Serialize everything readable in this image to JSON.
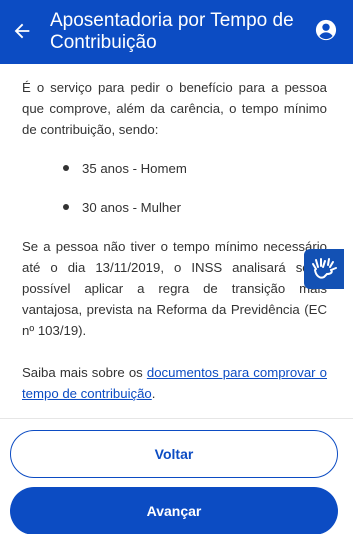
{
  "header": {
    "title": "Aposentadoria por Tempo de Contribuição",
    "back_icon": "arrow-left-icon",
    "account_icon": "user-circle-icon",
    "background": "#0c4cc3"
  },
  "content": {
    "intro": "É o serviço para pedir o benefício para a pessoa que comprove, além da carência, o tempo mínimo de contribuição, sendo:",
    "bullets": [
      "35 anos - Homem",
      "30 anos - Mulher"
    ],
    "transition": "Se a pessoa não tiver o tempo mínimo necessário até o dia 13/11/2019, o INSS analisará se é possível aplicar a regra de transição mais vantajosa, prevista na Reforma da Previdência (EC nº 103/19).",
    "more_prefix": "Saiba mais sobre os ",
    "more_link": "documentos para comprovar o tempo de contribuição",
    "more_suffix": "."
  },
  "accessibility": {
    "icon": "sign-language-hands-icon",
    "color": "#1351b4"
  },
  "footer": {
    "voltar_label": "Voltar",
    "avancar_label": "Avançar",
    "accent": "#0c4cc3"
  }
}
